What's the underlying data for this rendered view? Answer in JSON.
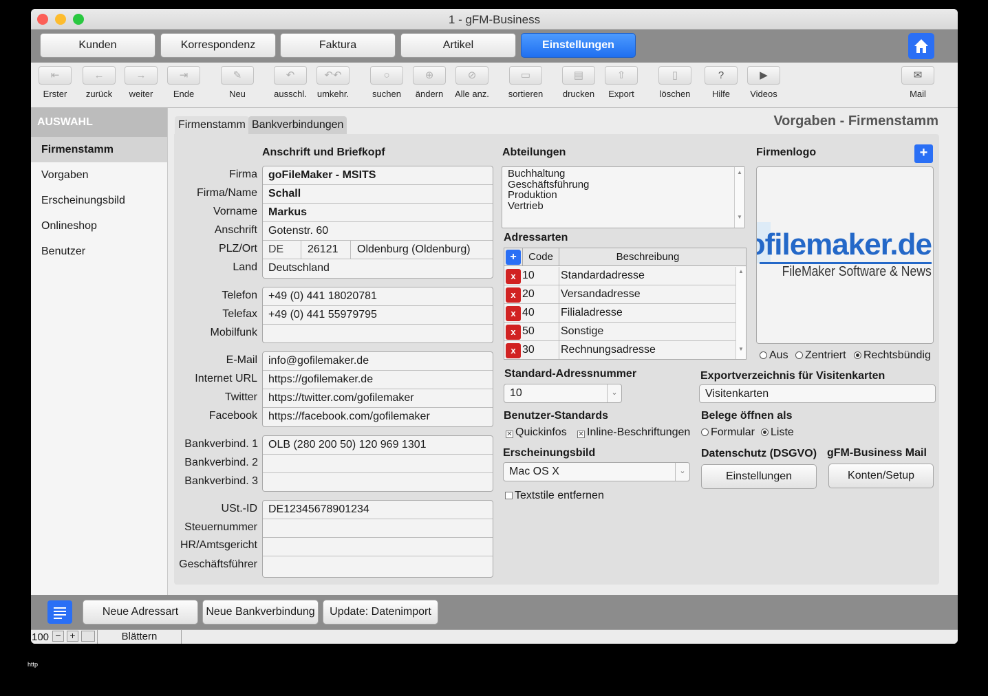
{
  "window": {
    "title": "1 - gFM-Business"
  },
  "nav": {
    "items": [
      "Kunden",
      "Korrespondenz",
      "Faktura",
      "Artikel",
      "Einstellungen"
    ],
    "active": "Einstellungen",
    "home_icon": "home-icon"
  },
  "toolbar": {
    "items": [
      {
        "label": "Erster",
        "icon": "first-icon"
      },
      {
        "label": "zurück",
        "icon": "back-icon"
      },
      {
        "label": "weiter",
        "icon": "forward-icon"
      },
      {
        "label": "Ende",
        "icon": "last-icon"
      },
      {
        "label": "Neu",
        "icon": "new-icon"
      },
      {
        "label": "ausschl.",
        "icon": "omit-icon"
      },
      {
        "label": "umkehr.",
        "icon": "invert-icon"
      },
      {
        "label": "suchen",
        "icon": "search-icon"
      },
      {
        "label": "ändern",
        "icon": "modify-find-icon"
      },
      {
        "label": "Alle anz.",
        "icon": "show-all-icon"
      },
      {
        "label": "sortieren",
        "icon": "sort-icon"
      },
      {
        "label": "drucken",
        "icon": "print-icon"
      },
      {
        "label": "Export",
        "icon": "export-icon"
      },
      {
        "label": "löschen",
        "icon": "trash-icon"
      },
      {
        "label": "Hilfe",
        "icon": "help-icon"
      },
      {
        "label": "Videos",
        "icon": "play-icon"
      },
      {
        "label": "Mail",
        "icon": "mail-icon"
      }
    ]
  },
  "sidebar": {
    "header": "AUSWAHL",
    "items": [
      "Firmenstamm",
      "Vorgaben",
      "Erscheinungsbild",
      "Onlineshop",
      "Benutzer"
    ],
    "selected": "Firmenstamm"
  },
  "tabs": [
    "Firmenstamm",
    "Bankverbindungen"
  ],
  "page_title": "Vorgaben - Firmenstamm",
  "anschrift": {
    "heading": "Anschrift und Briefkopf",
    "labels": {
      "firma": "Firma",
      "firma_name": "Firma/Name",
      "vorname": "Vorname",
      "anschrift": "Anschrift",
      "plz_ort": "PLZ/Ort",
      "land": "Land",
      "telefon": "Telefon",
      "telefax": "Telefax",
      "mobilfunk": "Mobilfunk",
      "email": "E-Mail",
      "url": "Internet URL",
      "twitter": "Twitter",
      "facebook": "Facebook",
      "bank1": "Bankverbind. 1",
      "bank2": "Bankverbind. 2",
      "bank3": "Bankverbind. 3",
      "ustid": "USt.-ID",
      "steuernummer": "Steuernummer",
      "hr": "HR/Amtsgericht",
      "gf": "Geschäftsführer"
    },
    "values": {
      "firma": "goFileMaker - MSITS",
      "firma_name": "Schall",
      "vorname": "Markus",
      "anschrift": "Gotenstr. 60",
      "land_code": "DE",
      "plz": "26121",
      "ort": "Oldenburg (Oldenburg)",
      "land": "Deutschland",
      "telefon": "+49 (0) 441 18020781",
      "telefax": "+49 (0) 441 55979795",
      "mobilfunk": "",
      "email": "info@gofilemaker.de",
      "url": "https://gofilemaker.de",
      "twitter": "https://twitter.com/gofilemaker",
      "facebook": "https://facebook.com/gofilemaker",
      "bank1": "OLB (280 200 50) 120 969 1301",
      "bank2": "",
      "bank3": "",
      "ustid": "DE12345678901234",
      "steuernummer": "",
      "hr": "",
      "gf": ""
    }
  },
  "abteilungen": {
    "heading": "Abteilungen",
    "items": [
      "Buchhaltung",
      "Geschäftsführung",
      "Produktion",
      "Vertrieb"
    ]
  },
  "adressarten": {
    "heading": "Adressarten",
    "columns": [
      "Code",
      "Beschreibung"
    ],
    "rows": [
      {
        "code": "10",
        "desc": "Standardadresse"
      },
      {
        "code": "20",
        "desc": "Versandadresse"
      },
      {
        "code": "40",
        "desc": "Filialadresse"
      },
      {
        "code": "50",
        "desc": "Sonstige"
      },
      {
        "code": "30",
        "desc": "Rechnungsadresse"
      }
    ]
  },
  "standard_adressnummer": {
    "heading": "Standard-Adressnummer",
    "value": "10"
  },
  "benutzer_standards": {
    "heading": "Benutzer-Standards",
    "quickinfos": "Quickinfos",
    "inline": "Inline-Beschriftungen",
    "quickinfos_checked": true,
    "inline_checked": true
  },
  "erscheinungsbild": {
    "heading": "Erscheinungsbild",
    "value": "Mac OS X",
    "textstile": "Textstile entfernen",
    "textstile_checked": false
  },
  "firmenlogo": {
    "heading": "Firmenlogo",
    "logo_text": "gofilemaker.de",
    "logo_sub": "FileMaker Software & News",
    "align_options": [
      "Aus",
      "Zentriert",
      "Rechtsbündig"
    ],
    "align_selected": "Rechtsbündig"
  },
  "export_dir": {
    "heading": "Exportverzeichnis für Visitenkarten",
    "value": "Visitenkarten"
  },
  "belege": {
    "heading": "Belege öffnen als",
    "options": [
      "Formular",
      "Liste"
    ],
    "selected": "Liste"
  },
  "datenschutz": {
    "heading": "Datenschutz (DSGVO)",
    "button": "Einstellungen"
  },
  "mail": {
    "heading": "gFM-Business Mail",
    "button": "Konten/Setup"
  },
  "bottom_buttons": [
    "Neue Adressart",
    "Neue Bankverbindung",
    "Update: Datenimport"
  ],
  "status": {
    "zoom": "100",
    "mode": "Blättern"
  },
  "outside_text": "http"
}
